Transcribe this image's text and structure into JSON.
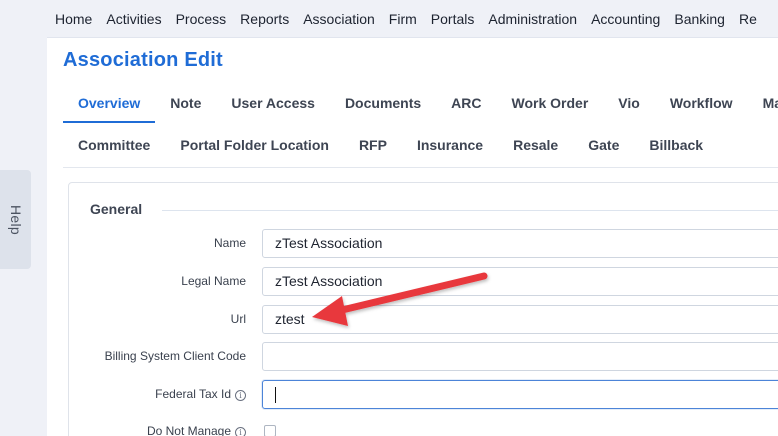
{
  "help": {
    "label": "Help"
  },
  "topnav": {
    "items": [
      "Home",
      "Activities",
      "Process",
      "Reports",
      "Association",
      "Firm",
      "Portals",
      "Administration",
      "Accounting",
      "Banking",
      "Re"
    ]
  },
  "page": {
    "title": "Association Edit"
  },
  "tabs": {
    "row1": [
      "Overview",
      "Note",
      "User Access",
      "Documents",
      "ARC",
      "Work Order",
      "Vio",
      "Workflow",
      "Map"
    ],
    "row2": [
      "Committee",
      "Portal Folder Location",
      "RFP",
      "Insurance",
      "Resale",
      "Gate",
      "Billback"
    ],
    "active": "Overview"
  },
  "section": {
    "title": "General"
  },
  "form": {
    "name": {
      "label": "Name",
      "value": "zTest Association"
    },
    "legal_name": {
      "label": "Legal Name",
      "value": "zTest Association"
    },
    "url": {
      "label": "Url",
      "value": "ztest"
    },
    "billing_code": {
      "label": "Billing System Client Code",
      "value": ""
    },
    "federal_tax_id": {
      "label": "Federal Tax Id",
      "value": ""
    },
    "do_not_manage": {
      "label": "Do Not Manage",
      "checked": false
    }
  },
  "annotation": {
    "arrow_color": "#e8393d",
    "icon": "red-arrow-icon"
  },
  "colors": {
    "accent": "#1f6cd6",
    "nav_bg": "#eff1f7"
  }
}
